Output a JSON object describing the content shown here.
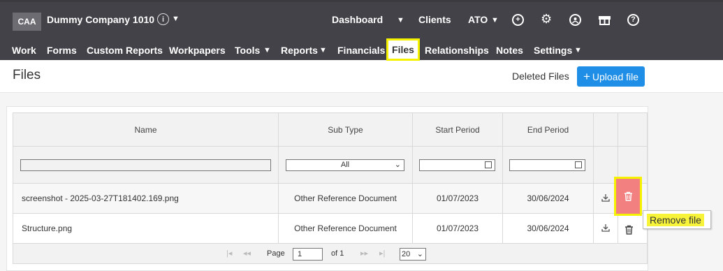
{
  "header": {
    "company_badge": "CAA",
    "company_name": "Dummy Company 1010",
    "links": {
      "dashboard": "Dashboard",
      "clients": "Clients",
      "ato": "ATO"
    }
  },
  "nav": {
    "items": [
      "Work",
      "Forms",
      "Custom Reports",
      "Workpapers",
      "Tools",
      "Reports",
      "Financials",
      "Files",
      "Relationships",
      "Notes",
      "Settings"
    ],
    "active": "Files"
  },
  "page": {
    "title": "Files",
    "deleted_files_label": "Deleted Files",
    "upload_label": "Upload file"
  },
  "table": {
    "columns": [
      "Name",
      "Sub Type",
      "Start Period",
      "End Period"
    ],
    "filter_subtype": "All",
    "rows": [
      {
        "name": "screenshot - 2025-03-27T181402.169.png",
        "sub_type": "Other Reference Document",
        "start": "01/07/2023",
        "end": "30/06/2024"
      },
      {
        "name": "Structure.png",
        "sub_type": "Other Reference Document",
        "start": "01/07/2023",
        "end": "30/06/2024"
      }
    ]
  },
  "pager": {
    "page_label": "Page",
    "page_value": "1",
    "of_label": "of 1",
    "per_page": "20"
  },
  "tooltip": "Remove file",
  "colors": {
    "header_bg": "#434248",
    "accent": "#1e8ee6",
    "highlight": "#f5f200",
    "delete_bg": "#f28080"
  }
}
